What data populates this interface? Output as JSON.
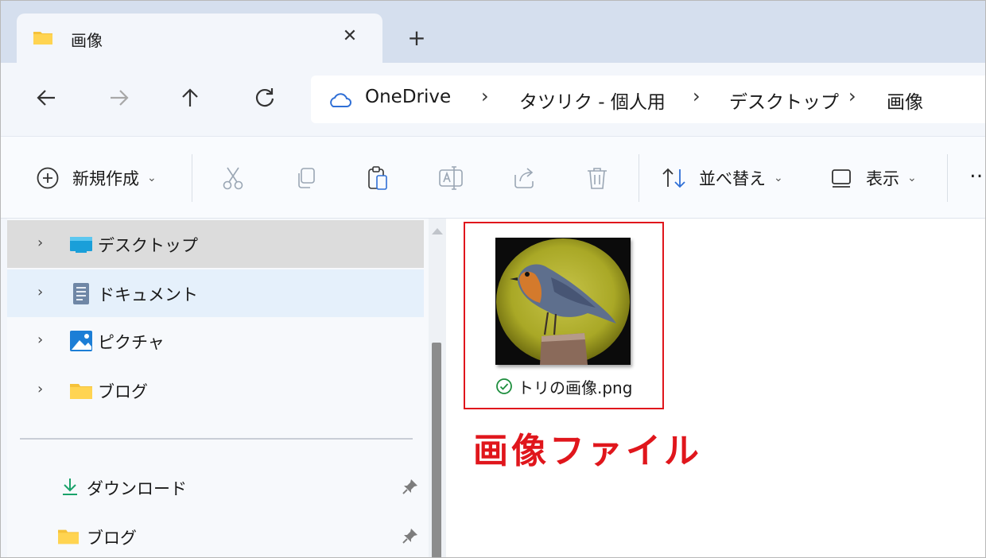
{
  "tab": {
    "title": "画像",
    "close_glyph": "✕",
    "new_tab_glyph": "+"
  },
  "address": {
    "crumbs": [
      "OneDrive",
      "タツリク - 個人用",
      "デスクトップ",
      "画像"
    ],
    "separator": "›"
  },
  "toolbar": {
    "new_label": "新規作成",
    "sort_label": "並べ替え",
    "view_label": "表示",
    "chevron": "⌄",
    "more": "…"
  },
  "sidebar": {
    "items": [
      {
        "label": "デスクトップ",
        "icon": "desktop-icon"
      },
      {
        "label": "ドキュメント",
        "icon": "document-icon"
      },
      {
        "label": "ピクチャ",
        "icon": "pictures-icon"
      },
      {
        "label": "ブログ",
        "icon": "folder-icon"
      }
    ],
    "quick_access": [
      {
        "label": "ダウンロード",
        "icon": "download-icon"
      },
      {
        "label": "ブログ",
        "icon": "folder-icon"
      }
    ],
    "expand_glyph": "›"
  },
  "content": {
    "file_name": "トリの画像.png",
    "annotation": "画像ファイル"
  },
  "colors": {
    "accent_red": "#e0161c",
    "selected_row": "#dcdcdc",
    "hover_row": "#e5f0fb"
  }
}
